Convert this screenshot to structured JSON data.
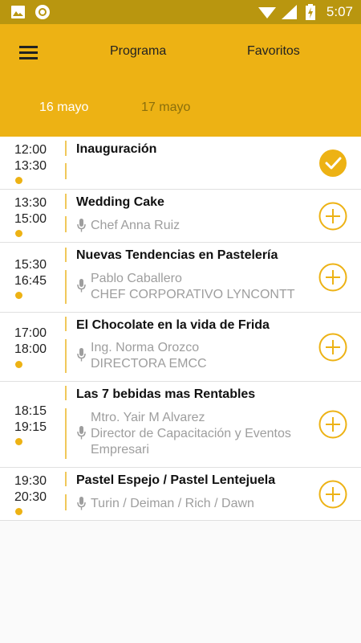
{
  "status_bar": {
    "time": "5:07"
  },
  "header": {
    "tab_program": "Programa",
    "tab_favorites": "Favoritos"
  },
  "days": [
    {
      "label": "16 mayo",
      "selected": true
    },
    {
      "label": "17 mayo",
      "selected": false
    }
  ],
  "sessions": [
    {
      "start": "12:00",
      "end": "13:30",
      "title": "Inauguración",
      "speaker_lines": [],
      "favorited": true
    },
    {
      "start": "13:30",
      "end": "15:00",
      "title": "Wedding Cake",
      "speaker_lines": [
        "Chef Anna Ruiz"
      ],
      "favorited": false
    },
    {
      "start": "15:30",
      "end": "16:45",
      "title": "Nuevas Tendencias en Pastelería",
      "speaker_lines": [
        "Pablo Caballero",
        "CHEF CORPORATIVO LYNCONTT"
      ],
      "favorited": false
    },
    {
      "start": "17:00",
      "end": "18:00",
      "title": "El Chocolate en la vida de Frida",
      "speaker_lines": [
        "Ing. Norma Orozco",
        "DIRECTORA EMCC"
      ],
      "favorited": false
    },
    {
      "start": "18:15",
      "end": "19:15",
      "title": "Las 7 bebidas mas Rentables",
      "speaker_lines": [
        "Mtro. Yair M Alvarez",
        "Director de Capacitación y Eventos",
        "Empresari"
      ],
      "favorited": false
    },
    {
      "start": "19:30",
      "end": "20:30",
      "title": "Pastel Espejo / Pastel Lentejuela",
      "speaker_lines": [
        "Turin / Deiman / Rich / Dawn"
      ],
      "favorited": false
    }
  ],
  "colors": {
    "accent": "#edb214",
    "status_bar": "#b9960f",
    "speaker_text": "#9e9e9e"
  }
}
